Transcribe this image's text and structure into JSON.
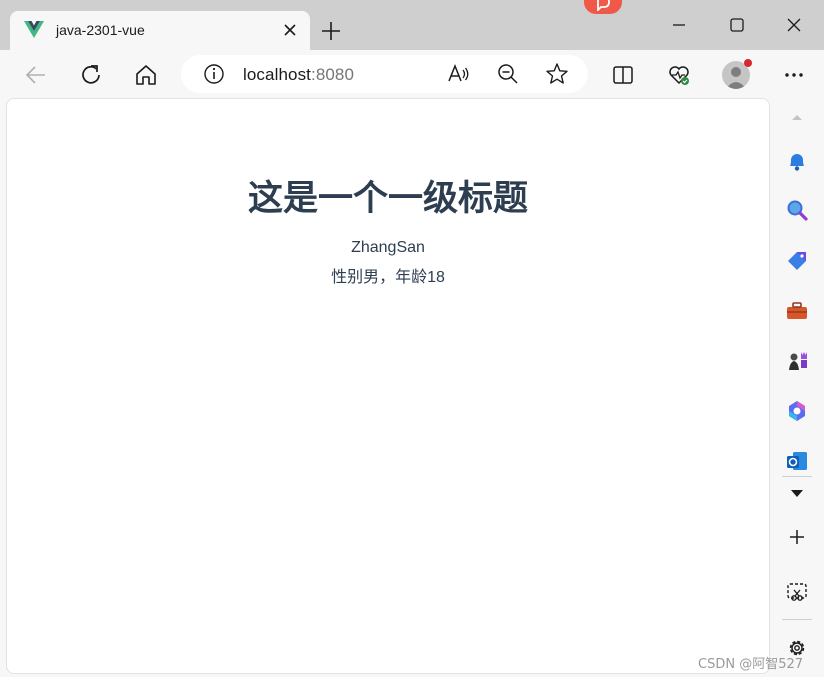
{
  "tab": {
    "title": "java-2301-vue"
  },
  "address": {
    "host": "localhost",
    "port": ":8080"
  },
  "page": {
    "heading": "这是一个一级标题",
    "name": "ZhangSan",
    "info": "性别男，年龄18"
  },
  "watermark": "CSDN @阿智527",
  "colors": {
    "text": "#2c3e50",
    "vue_green": "#41b883",
    "vue_dark": "#35495e",
    "notification_red": "#d9272e"
  },
  "icons": {
    "titlebar": [
      "vue-logo-icon",
      "close-tab-icon",
      "new-tab-icon",
      "minimize-icon",
      "maximize-icon",
      "close-window-icon"
    ],
    "toolbar": [
      "back-icon",
      "refresh-icon",
      "home-icon",
      "info-icon",
      "read-aloud-icon",
      "zoom-out-icon",
      "favorite-icon",
      "split-screen-icon",
      "browser-essentials-icon",
      "profile-icon",
      "more-icon"
    ],
    "sidebar": [
      "scroll-up-icon",
      "bell-icon",
      "search-icon",
      "shopping-icon",
      "tools-icon",
      "games-icon",
      "copilot-icon",
      "outlook-icon",
      "expand-icon",
      "add-icon",
      "screenshot-icon",
      "settings-icon"
    ]
  }
}
